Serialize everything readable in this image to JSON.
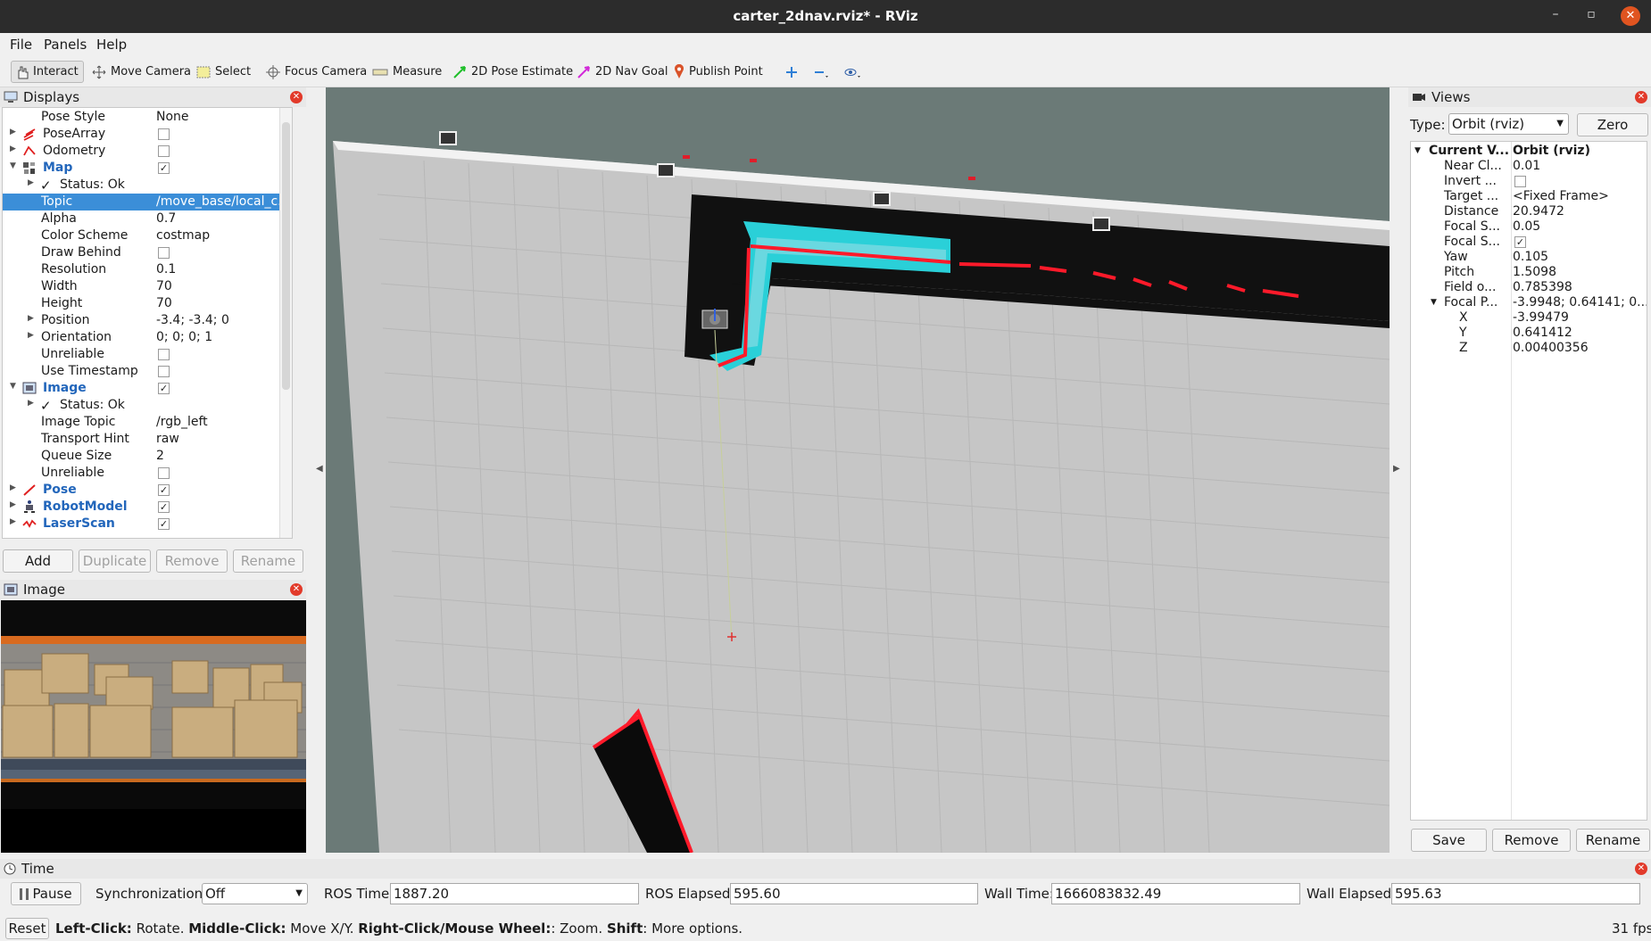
{
  "window": {
    "title": "carter_2dnav.rviz* - RViz"
  },
  "menu": [
    "File",
    "Panels",
    "Help"
  ],
  "toolbar": {
    "interact": "Interact",
    "move_camera": "Move Camera",
    "select": "Select",
    "focus_camera": "Focus Camera",
    "measure": "Measure",
    "pose_estimate": "2D Pose Estimate",
    "nav_goal": "2D Nav Goal",
    "publish_point": "Publish Point"
  },
  "displays": {
    "title": "Displays",
    "rows": [
      {
        "name": "Pose Style",
        "value": "None"
      },
      {
        "name": "PoseArray",
        "checked": false
      },
      {
        "name": "Odometry",
        "checked": false
      },
      {
        "name": "Map",
        "checked": true
      },
      {
        "name": "Status: Ok"
      },
      {
        "name": "Topic",
        "value": "/move_base/local_c..."
      },
      {
        "name": "Alpha",
        "value": "0.7"
      },
      {
        "name": "Color Scheme",
        "value": "costmap"
      },
      {
        "name": "Draw Behind",
        "checked": false
      },
      {
        "name": "Resolution",
        "value": "0.1"
      },
      {
        "name": "Width",
        "value": "70"
      },
      {
        "name": "Height",
        "value": "70"
      },
      {
        "name": "Position",
        "value": "-3.4; -3.4; 0"
      },
      {
        "name": "Orientation",
        "value": "0; 0; 0; 1"
      },
      {
        "name": "Unreliable",
        "checked": false
      },
      {
        "name": "Use Timestamp",
        "checked": false
      },
      {
        "name": "Image",
        "checked": true
      },
      {
        "name": "Status: Ok"
      },
      {
        "name": "Image Topic",
        "value": "/rgb_left"
      },
      {
        "name": "Transport Hint",
        "value": "raw"
      },
      {
        "name": "Queue Size",
        "value": "2"
      },
      {
        "name": "Unreliable",
        "checked": false
      },
      {
        "name": "Pose",
        "checked": true
      },
      {
        "name": "RobotModel",
        "checked": true
      },
      {
        "name": "LaserScan",
        "checked": true
      }
    ],
    "buttons": {
      "add": "Add",
      "duplicate": "Duplicate",
      "remove": "Remove",
      "rename": "Rename"
    }
  },
  "image_panel": {
    "title": "Image"
  },
  "views": {
    "title": "Views",
    "type_label": "Type:",
    "type_value": "Orbit (rviz)",
    "zero": "Zero",
    "rows": [
      {
        "key": "Current V...",
        "value": "Orbit (rviz)"
      },
      {
        "key": "Near Cl...",
        "value": "0.01"
      },
      {
        "key": "Invert ...",
        "checked": false
      },
      {
        "key": "Target ...",
        "value": "<Fixed Frame>"
      },
      {
        "key": "Distance",
        "value": "20.9472"
      },
      {
        "key": "Focal S...",
        "value": "0.05"
      },
      {
        "key": "Focal S...",
        "checked": true
      },
      {
        "key": "Yaw",
        "value": "0.105"
      },
      {
        "key": "Pitch",
        "value": "1.5098"
      },
      {
        "key": "Field o...",
        "value": "0.785398"
      },
      {
        "key": "Focal P...",
        "value": "-3.9948; 0.64141; 0...."
      },
      {
        "key": "X",
        "value": "-3.99479"
      },
      {
        "key": "Y",
        "value": "0.641412"
      },
      {
        "key": "Z",
        "value": "0.00400356"
      }
    ],
    "buttons": {
      "save": "Save",
      "remove": "Remove",
      "rename": "Rename"
    }
  },
  "time": {
    "title": "Time",
    "pause": "Pause",
    "sync_label": "Synchronization:",
    "sync_value": "Off",
    "ros_time_label": "ROS Time:",
    "ros_time": "1887.20",
    "ros_elapsed_label": "ROS Elapsed:",
    "ros_elapsed": "595.60",
    "wall_time_label": "Wall Time:",
    "wall_time": "1666083832.49",
    "wall_elapsed_label": "Wall Elapsed:",
    "wall_elapsed": "595.63"
  },
  "status": {
    "reset": "Reset",
    "h1": "Left-Click:",
    "t1": " Rotate. ",
    "h2": "Middle-Click:",
    "t2": " Move X/Y. ",
    "h3": "Right-Click/Mouse Wheel:",
    "t3": ": Zoom. ",
    "h4": "Shift",
    "t4": ": More options.",
    "fps": "31 fps"
  },
  "colors": {
    "selection": "#3b8ed8",
    "display_name": "#2266bb",
    "costmap_cyan": "#2ad0d8",
    "laser_red": "#ff1a2a",
    "floor": "#c4c4c4",
    "background": "#6b7a77"
  }
}
